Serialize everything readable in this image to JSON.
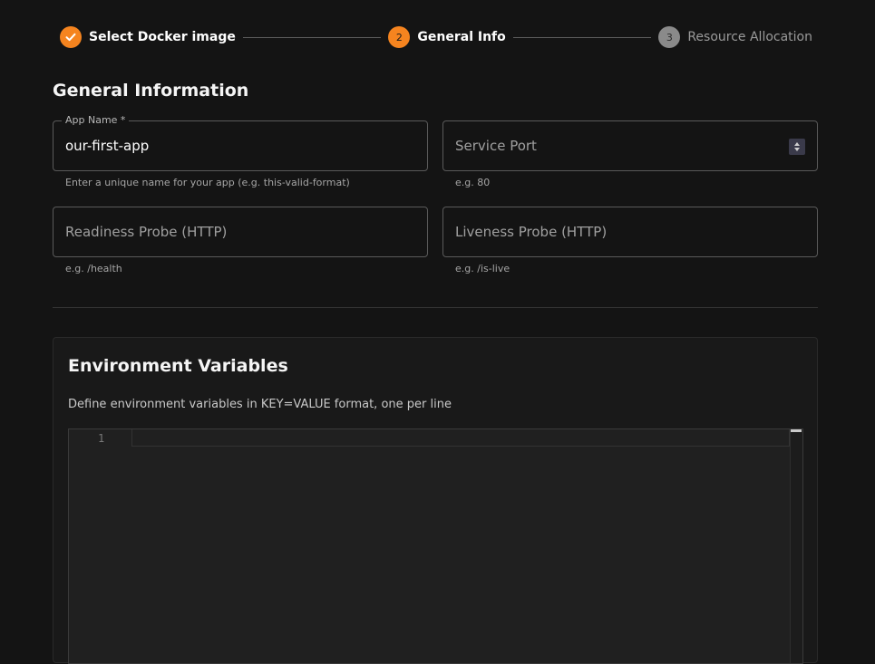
{
  "stepper": {
    "steps": [
      {
        "label": "Select Docker image",
        "state": "done",
        "number": ""
      },
      {
        "label": "General Info",
        "state": "active",
        "number": "2"
      },
      {
        "label": "Resource Allocation",
        "state": "inactive",
        "number": "3"
      }
    ]
  },
  "section": {
    "title": "General Information"
  },
  "form": {
    "app_name": {
      "label": "App Name *",
      "value": "our-first-app",
      "helper": "Enter a unique name for your app (e.g. this-valid-format)"
    },
    "service_port": {
      "placeholder": "Service Port",
      "helper": "e.g. 80"
    },
    "readiness_probe": {
      "placeholder": "Readiness Probe (HTTP)",
      "helper": "e.g. /health"
    },
    "liveness_probe": {
      "placeholder": "Liveness Probe (HTTP)",
      "helper": "e.g. /is-live"
    }
  },
  "env": {
    "title": "Environment Variables",
    "description": "Define environment variables in KEY=VALUE format, one per line",
    "line_number": "1"
  },
  "colors": {
    "accent": "#f5841f",
    "background": "#141414"
  },
  "icons": {
    "done_step": "check-icon",
    "spinner": "number-spinner-icon"
  }
}
